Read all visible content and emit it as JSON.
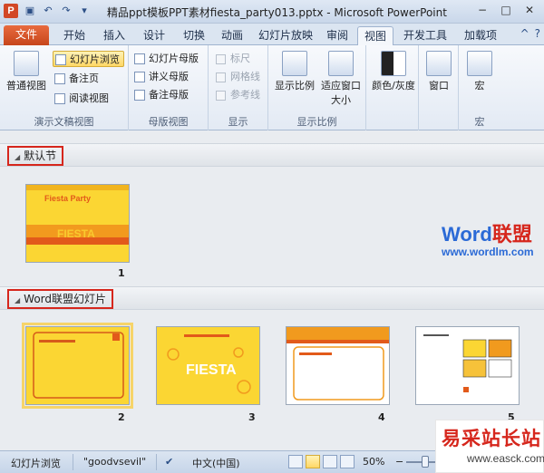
{
  "titlebar": {
    "app_icon_letter": "P",
    "title": "精品ppt模板PPT素材fiesta_party013.pptx - Microsoft PowerPoint",
    "qat_icons": [
      "save-icon",
      "undo-icon",
      "redo-icon",
      "customize-icon"
    ]
  },
  "tabs": {
    "file": "文件",
    "home": "开始",
    "insert": "插入",
    "design": "设计",
    "transitions": "切换",
    "animations": "动画",
    "slideshow": "幻灯片放映",
    "review": "审阅",
    "view": "视图",
    "developer": "开发工具",
    "addins": "加载项"
  },
  "ribbon": {
    "presentation_views": {
      "label": "演示文稿视图",
      "normal": "普通视图",
      "slide_sorter": "幻灯片浏览",
      "notes_page": "备注页",
      "reading_view": "阅读视图"
    },
    "master_views": {
      "label": "母版视图",
      "slide_master": "幻灯片母版",
      "handout_master": "讲义母版",
      "notes_master": "备注母版"
    },
    "show": {
      "label": "显示",
      "ruler": "标尺",
      "gridlines": "网格线",
      "guides": "参考线"
    },
    "zoom": {
      "label": "显示比例",
      "zoom": "显示比例",
      "fit_window": "适应窗口大小"
    },
    "color": {
      "label": "颜色/灰度"
    },
    "window": {
      "label": "窗口"
    },
    "macros": {
      "label": "宏",
      "button": "宏"
    }
  },
  "sections": [
    {
      "name": "默认节",
      "slides": [
        {
          "number": "1",
          "title": "Fiesta Party",
          "subtitle": "FIESTA"
        }
      ]
    },
    {
      "name": "Word联盟幻灯片",
      "slides": [
        {
          "number": "2"
        },
        {
          "number": "3",
          "title": "FIESTA"
        },
        {
          "number": "4"
        },
        {
          "number": "5"
        }
      ]
    }
  ],
  "watermark": {
    "brand_a": "Word",
    "brand_b": "联盟",
    "url": "www.wordlm.com"
  },
  "statusbar": {
    "view_name": "幻灯片浏览",
    "theme": "\"goodvsevil\"",
    "language": "中文(中国)",
    "zoom": "50%"
  },
  "site_logo": {
    "line1": "易采站长站",
    "line2": "www.easck.com"
  }
}
